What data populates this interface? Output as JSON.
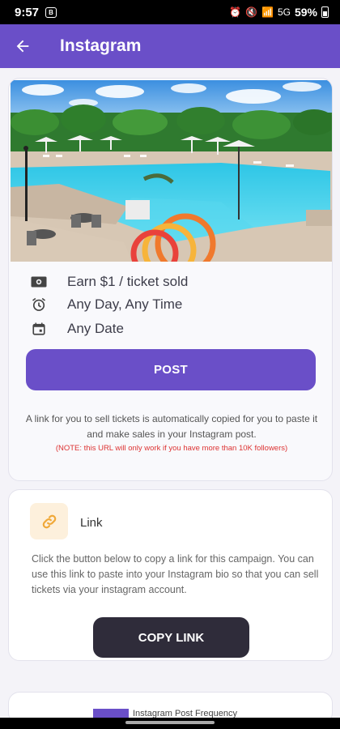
{
  "status_bar": {
    "time": "9:57",
    "app_badge": "B",
    "network": "5G",
    "battery": "59%"
  },
  "app_bar": {
    "title": "Instagram"
  },
  "campaign": {
    "earn": "Earn $1 / ticket sold",
    "schedule": "Any Day, Any Time",
    "date": "Any Date",
    "post_label": "POST",
    "description": "A link for you to sell tickets is automatically copied for you to paste it and make sales in your Instagram post.",
    "note": "(NOTE: this URL will only work if you have more than 10K followers)"
  },
  "link_card": {
    "title": "Link",
    "description": "Click the button below to copy a link for this campaign. You can use this link to paste into your Instagram bio so that you can sell tickets via your instagram account.",
    "copy_label": "COPY LINK"
  },
  "frequency_card": {
    "label": "Instagram Post Frequency"
  },
  "colors": {
    "primary": "#6a4fc8",
    "dark_button": "#2f2c3a",
    "note_red": "#dd3333"
  }
}
